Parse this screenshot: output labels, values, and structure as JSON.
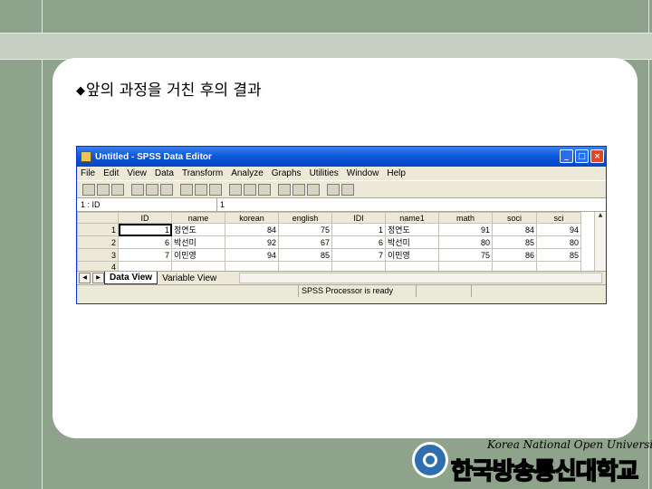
{
  "slide": {
    "heading": "앞의 과정을 거친 후의 결과",
    "bullet_symbol": "◆"
  },
  "window": {
    "title": "Untitled - SPSS Data Editor",
    "controls": [
      "_",
      "□",
      "×"
    ]
  },
  "menu": [
    {
      "label": "File"
    },
    {
      "label": "Edit"
    },
    {
      "label": "View"
    },
    {
      "label": "Data"
    },
    {
      "label": "Transform"
    },
    {
      "label": "Analyze"
    },
    {
      "label": "Graphs"
    },
    {
      "label": "Utilities"
    },
    {
      "label": "Window"
    },
    {
      "label": "Help"
    }
  ],
  "cell_editor": {
    "ref": "1 : ID",
    "value": "1"
  },
  "grid": {
    "columns": [
      "ID",
      "name",
      "korean",
      "english",
      "IDI",
      "name1",
      "math",
      "soci",
      "sci"
    ],
    "rows": [
      {
        "n": "1",
        "cells": [
          "1",
          "정연도",
          "84",
          "75",
          "1",
          "정연도",
          "91",
          "84",
          "94"
        ]
      },
      {
        "n": "2",
        "cells": [
          "6",
          "박선미",
          "92",
          "67",
          "6",
          "박선미",
          "80",
          "85",
          "80"
        ]
      },
      {
        "n": "3",
        "cells": [
          "7",
          "이민영",
          "94",
          "85",
          "7",
          "이민영",
          "75",
          "86",
          "85"
        ]
      },
      {
        "n": "4",
        "cells": [
          "",
          "",
          "",
          "",
          "",
          "",
          "",
          "",
          ""
        ]
      }
    ]
  },
  "tabs": {
    "data_view": "Data View",
    "variable_view": "Variable View"
  },
  "status": {
    "text": "SPSS Processor  is ready"
  },
  "footer": {
    "univ_en": "Korea National Open University",
    "univ_kr": "한국방송통신대학교"
  }
}
